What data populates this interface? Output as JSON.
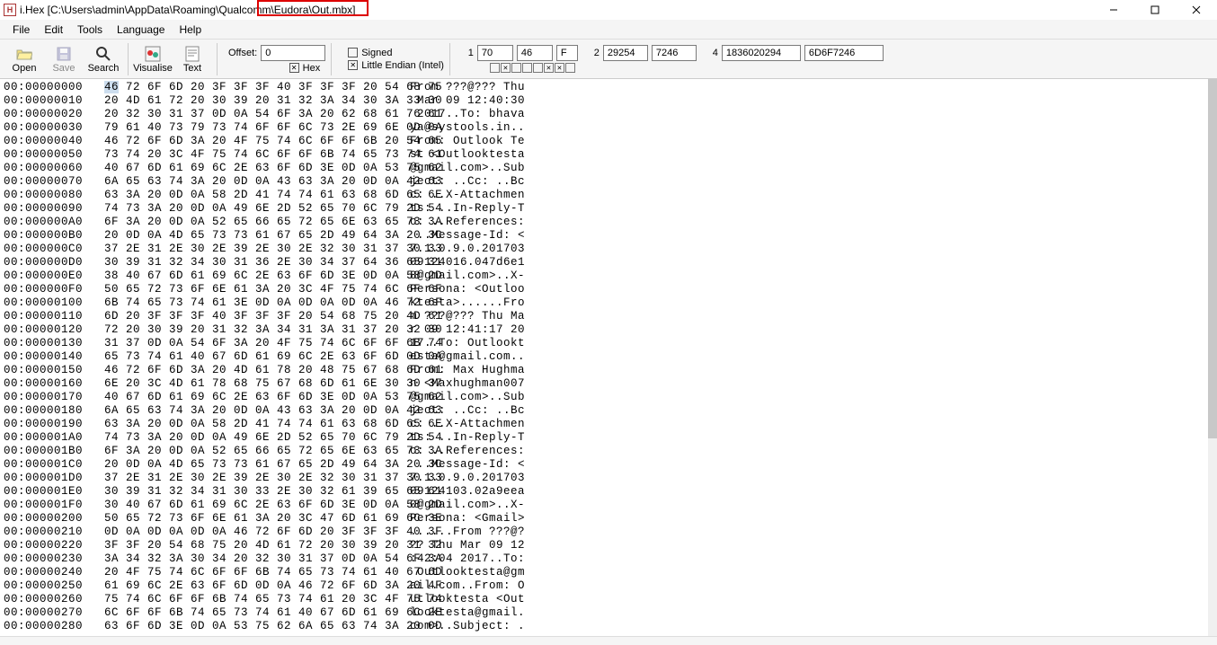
{
  "window": {
    "title": "i.Hex [C:\\Users\\admin\\AppData\\Roaming\\Qualcomm\\Eudora\\Out.mbx]",
    "app_icon_letter": "H"
  },
  "menubar": [
    "File",
    "Edit",
    "Tools",
    "Language",
    "Help"
  ],
  "toolbar": {
    "open": "Open",
    "save": "Save",
    "search": "Search",
    "visualise": "Visualise",
    "text": "Text"
  },
  "offset": {
    "label": "Offset:",
    "value": "0",
    "hex_label": "Hex",
    "hex_checked": true
  },
  "endian": {
    "signed_label": "Signed",
    "signed_checked": false,
    "little_label": "Little Endian (Intel)",
    "little_checked": true
  },
  "values": {
    "v1": {
      "label": "1",
      "a": "70",
      "b": "46",
      "c": "F"
    },
    "v2": {
      "label": "2",
      "a": "29254",
      "b": "7246"
    },
    "v4": {
      "label": "4",
      "a": "1836020294",
      "b": "6D6F7246"
    },
    "bits": [
      false,
      true,
      false,
      false,
      false,
      true,
      true,
      false
    ]
  },
  "hex": {
    "rows": [
      {
        "addr": "00:00000000",
        "hex": "46 72 6F 6D 20 3F 3F 3F 40 3F 3F 3F 20 54 68 75",
        "ascii": "From ???@??? Thu"
      },
      {
        "addr": "00:00000010",
        "hex": "20 4D 61 72 20 30 39 20 31 32 3A 34 30 3A 33 30",
        "ascii": " Mar 09 12:40:30"
      },
      {
        "addr": "00:00000020",
        "hex": "20 32 30 31 37 0D 0A 54 6F 3A 20 62 68 61 76 61",
        "ascii": " 2017..To: bhava"
      },
      {
        "addr": "00:00000030",
        "hex": "79 61 40 73 79 73 74 6F 6F 6C 73 2E 69 6E 0D 0A",
        "ascii": "ya@systools.in.."
      },
      {
        "addr": "00:00000040",
        "hex": "46 72 6F 6D 3A 20 4F 75 74 6C 6F 6F 6B 20 54 65",
        "ascii": "From: Outlook Te"
      },
      {
        "addr": "00:00000050",
        "hex": "73 74 20 3C 4F 75 74 6C 6F 6F 6B 74 65 73 74 61",
        "ascii": "st <Outlooktesta"
      },
      {
        "addr": "00:00000060",
        "hex": "40 67 6D 61 69 6C 2E 63 6F 6D 3E 0D 0A 53 75 62",
        "ascii": "@gmail.com>..Sub"
      },
      {
        "addr": "00:00000070",
        "hex": "6A 65 63 74 3A 20 0D 0A 43 63 3A 20 0D 0A 42 63",
        "ascii": "ject: ..Cc: ..Bc"
      },
      {
        "addr": "00:00000080",
        "hex": "63 3A 20 0D 0A 58 2D 41 74 74 61 63 68 6D 65 6E",
        "ascii": "c: ..X-Attachmen"
      },
      {
        "addr": "00:00000090",
        "hex": "74 73 3A 20 0D 0A 49 6E 2D 52 65 70 6C 79 2D 54",
        "ascii": "ts: ..In-Reply-T"
      },
      {
        "addr": "00:000000A0",
        "hex": "6F 3A 20 0D 0A 52 65 66 65 72 65 6E 63 65 73 3A",
        "ascii": "o: ..References:"
      },
      {
        "addr": "00:000000B0",
        "hex": "20 0D 0A 4D 65 73 73 61 67 65 2D 49 64 3A 20 3C",
        "ascii": " ..Message-Id: <"
      },
      {
        "addr": "00:000000C0",
        "hex": "37 2E 31 2E 30 2E 39 2E 30 2E 32 30 31 37 30 33",
        "ascii": "7.1.0.9.0.201703"
      },
      {
        "addr": "00:000000D0",
        "hex": "30 39 31 32 34 30 31 36 2E 30 34 37 64 36 65 31",
        "ascii": "09124016.047d6e1"
      },
      {
        "addr": "00:000000E0",
        "hex": "38 40 67 6D 61 69 6C 2E 63 6F 6D 3E 0D 0A 58 2D",
        "ascii": "8@gmail.com>..X-"
      },
      {
        "addr": "00:000000F0",
        "hex": "50 65 72 73 6F 6E 61 3A 20 3C 4F 75 74 6C 6F 6F",
        "ascii": "Persona: <Outloo"
      },
      {
        "addr": "00:00000100",
        "hex": "6B 74 65 73 74 61 3E 0D 0A 0D 0A 0D 0A 46 72 6F",
        "ascii": "ktesta>......Fro"
      },
      {
        "addr": "00:00000110",
        "hex": "6D 20 3F 3F 3F 40 3F 3F 3F 20 54 68 75 20 4D 61",
        "ascii": "m ???@??? Thu Ma"
      },
      {
        "addr": "00:00000120",
        "hex": "72 20 30 39 20 31 32 3A 34 31 3A 31 37 20 32 30",
        "ascii": "r 09 12:41:17 20"
      },
      {
        "addr": "00:00000130",
        "hex": "31 37 0D 0A 54 6F 3A 20 4F 75 74 6C 6F 6F 6B 74",
        "ascii": "17..To: Outlookt"
      },
      {
        "addr": "00:00000140",
        "hex": "65 73 74 61 40 67 6D 61 69 6C 2E 63 6F 6D 0D 0A",
        "ascii": "esta@gmail.com.."
      },
      {
        "addr": "00:00000150",
        "hex": "46 72 6F 6D 3A 20 4D 61 78 20 48 75 67 68 6D 61",
        "ascii": "From: Max Hughma"
      },
      {
        "addr": "00:00000160",
        "hex": "6E 20 3C 4D 61 78 68 75 67 68 6D 61 6E 30 30 37",
        "ascii": "n <Maxhughman007"
      },
      {
        "addr": "00:00000170",
        "hex": "40 67 6D 61 69 6C 2E 63 6F 6D 3E 0D 0A 53 75 62",
        "ascii": "@gmail.com>..Sub"
      },
      {
        "addr": "00:00000180",
        "hex": "6A 65 63 74 3A 20 0D 0A 43 63 3A 20 0D 0A 42 63",
        "ascii": "ject: ..Cc: ..Bc"
      },
      {
        "addr": "00:00000190",
        "hex": "63 3A 20 0D 0A 58 2D 41 74 74 61 63 68 6D 65 6E",
        "ascii": "c: ..X-Attachmen"
      },
      {
        "addr": "00:000001A0",
        "hex": "74 73 3A 20 0D 0A 49 6E 2D 52 65 70 6C 79 2D 54",
        "ascii": "ts: ..In-Reply-T"
      },
      {
        "addr": "00:000001B0",
        "hex": "6F 3A 20 0D 0A 52 65 66 65 72 65 6E 63 65 73 3A",
        "ascii": "o: ..References:"
      },
      {
        "addr": "00:000001C0",
        "hex": "20 0D 0A 4D 65 73 73 61 67 65 2D 49 64 3A 20 3C",
        "ascii": " ..Message-Id: <"
      },
      {
        "addr": "00:000001D0",
        "hex": "37 2E 31 2E 30 2E 39 2E 30 2E 32 30 31 37 30 33",
        "ascii": "7.1.0.9.0.201703"
      },
      {
        "addr": "00:000001E0",
        "hex": "30 39 31 32 34 31 30 33 2E 30 32 61 39 65 65 61",
        "ascii": "09124103.02a9eea"
      },
      {
        "addr": "00:000001F0",
        "hex": "30 40 67 6D 61 69 6C 2E 63 6F 6D 3E 0D 0A 58 2D",
        "ascii": "0@gmail.com>..X-"
      },
      {
        "addr": "00:00000200",
        "hex": "50 65 72 73 6F 6E 61 3A 20 3C 47 6D 61 69 6C 3E",
        "ascii": "Persona: <Gmail>"
      },
      {
        "addr": "00:00000210",
        "hex": "0D 0A 0D 0A 0D 0A 46 72 6F 6D 20 3F 3F 3F 40 3F",
        "ascii": "......From ???@?"
      },
      {
        "addr": "00:00000220",
        "hex": "3F 3F 20 54 68 75 20 4D 61 72 20 30 39 20 31 32",
        "ascii": "?? Thu Mar 09 12"
      },
      {
        "addr": "00:00000230",
        "hex": "3A 34 32 3A 30 34 20 32 30 31 37 0D 0A 54 6F 3A",
        "ascii": ":42:04 2017..To:"
      },
      {
        "addr": "00:00000240",
        "hex": "20 4F 75 74 6C 6F 6F 6B 74 65 73 74 61 40 67 6D",
        "ascii": " Outlooktesta@gm"
      },
      {
        "addr": "00:00000250",
        "hex": "61 69 6C 2E 63 6F 6D 0D 0A 46 72 6F 6D 3A 20 4F",
        "ascii": "ail.com..From: O"
      },
      {
        "addr": "00:00000260",
        "hex": "75 74 6C 6F 6F 6B 74 65 73 74 61 20 3C 4F 75 74",
        "ascii": "utlooktesta <Out"
      },
      {
        "addr": "00:00000270",
        "hex": "6C 6F 6F 6B 74 65 73 74 61 40 67 6D 61 69 6C 2E",
        "ascii": "looktesta@gmail."
      },
      {
        "addr": "00:00000280",
        "hex": "63 6F 6D 3E 0D 0A 53 75 62 6A 65 63 74 3A 20 0D",
        "ascii": "com>..Subject: ."
      }
    ]
  }
}
